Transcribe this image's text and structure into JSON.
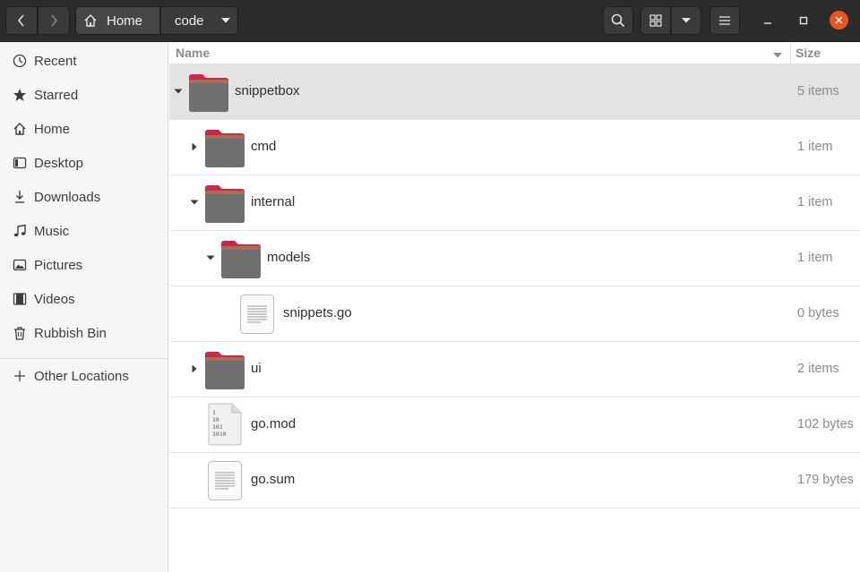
{
  "header": {
    "path": [
      {
        "label": "Home",
        "icon": "home-icon"
      },
      {
        "label": "code",
        "icon": "chevron-down-icon"
      }
    ]
  },
  "sidebar": {
    "items": [
      {
        "label": "Recent",
        "icon": "clock-icon"
      },
      {
        "label": "Starred",
        "icon": "star-icon"
      },
      {
        "label": "Home",
        "icon": "home-icon"
      },
      {
        "label": "Desktop",
        "icon": "desktop-icon"
      },
      {
        "label": "Downloads",
        "icon": "download-icon"
      },
      {
        "label": "Music",
        "icon": "music-icon"
      },
      {
        "label": "Pictures",
        "icon": "picture-icon"
      },
      {
        "label": "Videos",
        "icon": "video-icon"
      },
      {
        "label": "Rubbish Bin",
        "icon": "trash-icon"
      },
      {
        "label": "Other Locations",
        "icon": "plus-icon"
      }
    ]
  },
  "columns": {
    "name": "Name",
    "size": "Size"
  },
  "files": [
    {
      "name": "snippetbox",
      "size": "5 items",
      "type": "folder",
      "expanded": true,
      "selected": true
    },
    {
      "name": "cmd",
      "size": "1 item",
      "type": "folder",
      "expanded": false
    },
    {
      "name": "internal",
      "size": "1 item",
      "type": "folder",
      "expanded": true
    },
    {
      "name": "models",
      "size": "1 item",
      "type": "folder",
      "expanded": true
    },
    {
      "name": "snippets.go",
      "size": "0 bytes",
      "type": "text-file"
    },
    {
      "name": "ui",
      "size": "2 items",
      "type": "folder",
      "expanded": false
    },
    {
      "name": "go.mod",
      "size": "102 bytes",
      "type": "binary-file"
    },
    {
      "name": "go.sum",
      "size": "179 bytes",
      "type": "text-file"
    }
  ],
  "colors": {
    "accent": "#e95420",
    "folder_tab": "#c7294e",
    "folder_body": "#6f6f6f",
    "headerbar": "#2c2c2c"
  }
}
